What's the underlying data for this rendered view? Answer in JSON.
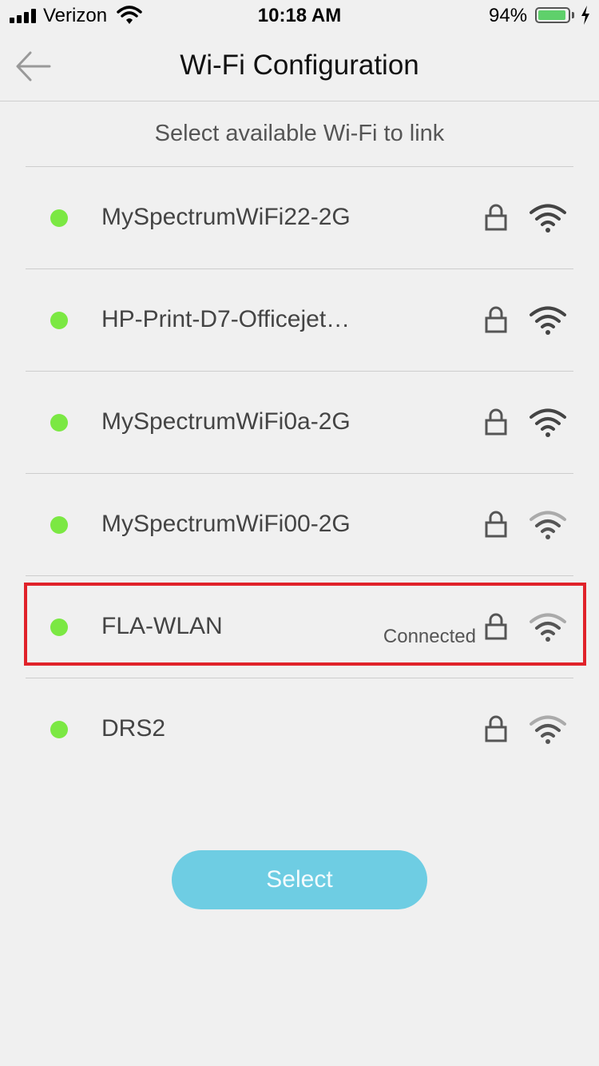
{
  "status_bar": {
    "carrier": "Verizon",
    "time": "10:18 AM",
    "battery_percent": "94%",
    "battery_level": 0.94
  },
  "nav": {
    "title": "Wi-Fi Configuration",
    "back_icon": "back-arrow-icon"
  },
  "subtitle": "Select available Wi-Fi to link",
  "networks": [
    {
      "ssid": "MySpectrumWiFi22-2G",
      "status": "",
      "locked": true,
      "signal": "strong"
    },
    {
      "ssid": "HP-Print-D7-Officejet…",
      "status": "",
      "locked": true,
      "signal": "strong"
    },
    {
      "ssid": "MySpectrumWiFi0a-2G",
      "status": "",
      "locked": true,
      "signal": "strong"
    },
    {
      "ssid": "MySpectrumWiFi00-2G",
      "status": "",
      "locked": true,
      "signal": "medium"
    },
    {
      "ssid": "FLA-WLAN",
      "status": "Connected",
      "locked": true,
      "signal": "medium"
    },
    {
      "ssid": "DRS2",
      "status": "",
      "locked": true,
      "signal": "medium"
    }
  ],
  "select_button": "Select",
  "colors": {
    "available_dot": "#7be843",
    "button": "#6ecde3",
    "highlight": "#e0222a"
  }
}
